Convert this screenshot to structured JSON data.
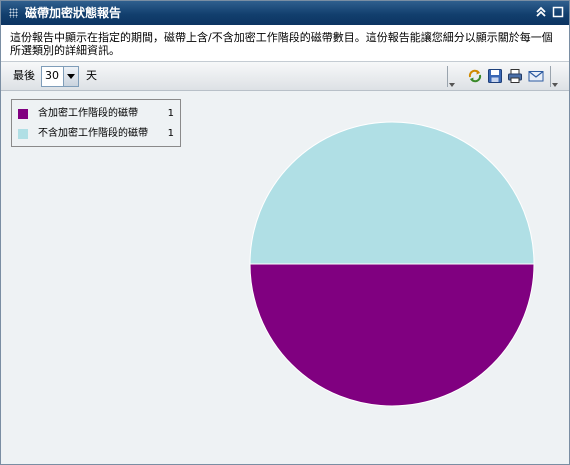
{
  "window": {
    "title": "磁帶加密狀態報告"
  },
  "description": "這份報告中顯示在指定的期間，磁帶上含/不含加密工作階段的磁帶數目。這份報告能讓您細分以顯示關於每一個所選類別的詳細資訊。",
  "toolbar": {
    "prefix_label": "最後",
    "days_value": "30",
    "suffix_label": "天",
    "icons": [
      "refresh-icon",
      "save-icon",
      "print-icon",
      "email-icon"
    ]
  },
  "legend": [
    {
      "label": "含加密工作階段的磁帶",
      "value": "1"
    },
    {
      "label": "不含加密工作階段的磁帶",
      "value": "1"
    }
  ],
  "chart_data": {
    "type": "pie",
    "categories": [
      "含加密工作階段的磁帶",
      "不含加密工作階段的磁帶"
    ],
    "values": [
      1,
      1
    ],
    "colors": [
      "#800080",
      "#b0dfe5"
    ],
    "legend_position": "top-left"
  }
}
